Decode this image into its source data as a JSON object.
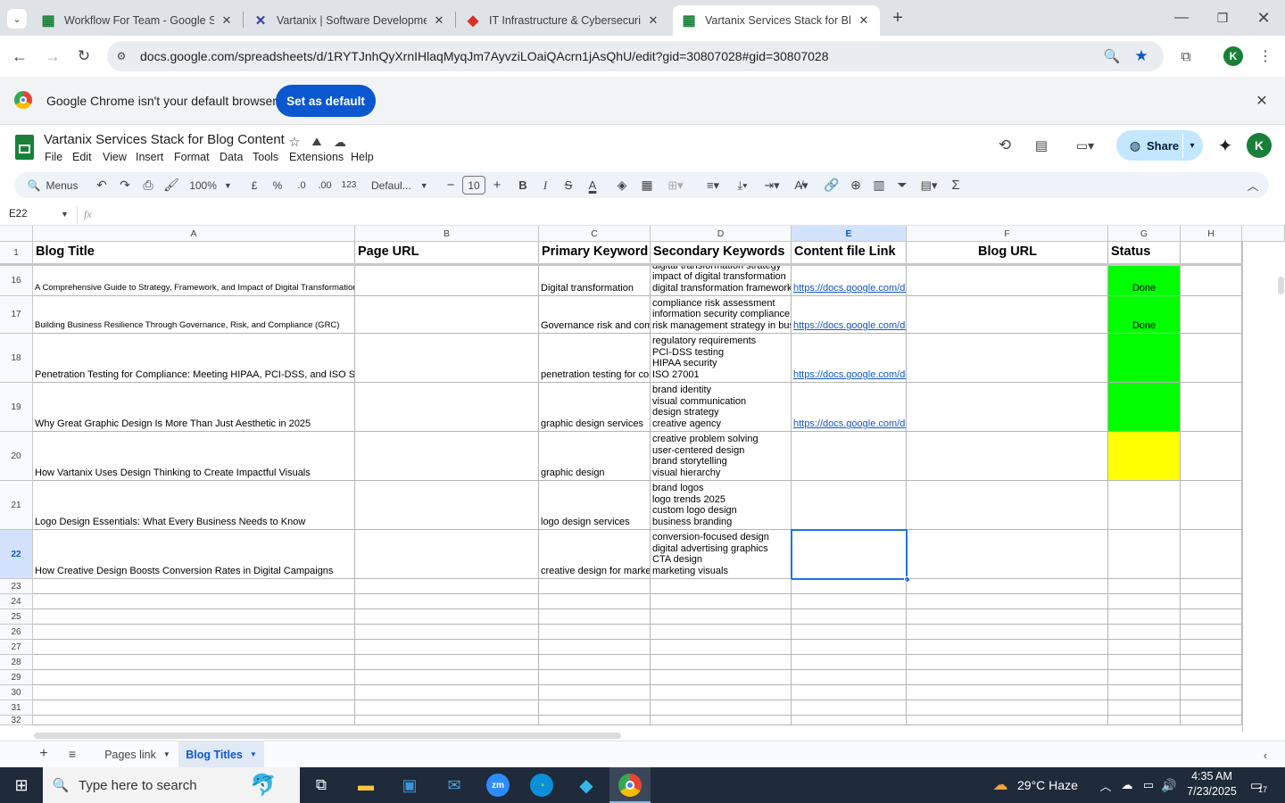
{
  "tabs": [
    {
      "title": "Workflow For Team - Google Sh",
      "fav": "sheets",
      "color": "#188038"
    },
    {
      "title": "Vartanix | Software Developmen",
      "fav": "x-logo",
      "color": "#2b3aa8"
    },
    {
      "title": "IT Infrastructure & Cybersecurit",
      "fav": "diamond",
      "color": "#d93025"
    },
    {
      "title": "Vartanix Services Stack for Blog",
      "fav": "sheets",
      "color": "#188038"
    }
  ],
  "url": "docs.google.com/spreadsheets/d/1RYTJnhQyXrnIHlaqMyqJm7AyvziLOaiQAcrn1jAsQhU/edit?gid=30807028#gid=30807028",
  "infobar": {
    "message": "Google Chrome isn't your default browser",
    "button": "Set as default"
  },
  "doc": {
    "title": "Vartanix Services Stack for Blog Content"
  },
  "menus": [
    "File",
    "Edit",
    "View",
    "Insert",
    "Format",
    "Data",
    "Tools",
    "Extensions",
    "Help"
  ],
  "toolbar": {
    "menus": "Menus",
    "zoom": "100%",
    "currency": "£",
    "percent": "%",
    "dec_less": ".0",
    "dec_more": ".00",
    "format123": "123",
    "font": "Defaul...",
    "font_size": "10",
    "bold": "B",
    "italic": "I",
    "strike": "S",
    "textcolor": "A"
  },
  "share": "Share",
  "avatar": "K",
  "namebox": "E22",
  "fx": "fx",
  "columns": [
    "A",
    "B",
    "C",
    "D",
    "E",
    "F",
    "G",
    "H"
  ],
  "headers": {
    "a": "Blog Title",
    "b": "Page URL",
    "c": "Primary Keyword",
    "d": "Secondary Keywords",
    "e": "Content file Link",
    "f": "Blog URL",
    "g": "Status"
  },
  "rows": [
    {
      "num": "16",
      "title": "A Comprehensive Guide to Strategy, Framework, and Impact of Digital Transformation",
      "primary": "Digital transformation",
      "secondary": [
        "digital transformation strategy",
        "impact of digital transformation",
        "digital transformation framework"
      ],
      "link": "https://docs.google.com/do",
      "status": "Done",
      "color": "green"
    },
    {
      "num": "17",
      "title": "Building Business Resilience Through Governance, Risk, and Compliance (GRC)",
      "primary": "Governance risk and com",
      "secondary": [
        "compliance risk assessment",
        "information security compliance",
        "risk management strategy in bus"
      ],
      "link": "https://docs.google.com/do",
      "status": "Done",
      "color": "green"
    },
    {
      "num": "18",
      "title": "Penetration Testing for Compliance: Meeting HIPAA, PCI-DSS, and ISO Sta",
      "primary": "penetration testing for cor",
      "secondary": [
        "regulatory requirements",
        "PCI-DSS testing",
        "HIPAA security",
        "ISO 27001"
      ],
      "link": "https://docs.google.com/do",
      "status": "",
      "color": "green"
    },
    {
      "num": "19",
      "title": "Why Great Graphic Design Is More Than Just Aesthetic in 2025",
      "primary": "graphic design services",
      "secondary": [
        "brand identity",
        "visual communication",
        "design strategy",
        "creative agency"
      ],
      "link": "https://docs.google.com/do",
      "status": "",
      "color": "green"
    },
    {
      "num": "20",
      "title": "How Vartanix Uses Design Thinking to Create Impactful Visuals",
      "primary": "graphic design",
      "secondary": [
        "creative problem solving",
        "user-centered design",
        "brand storytelling",
        "visual hierarchy"
      ],
      "link": "",
      "status": "",
      "color": "yellow"
    },
    {
      "num": "21",
      "title": "Logo Design Essentials: What Every Business Needs to Know",
      "primary": "logo design services",
      "secondary": [
        "brand logos",
        "logo trends 2025",
        "custom logo design",
        "business branding"
      ],
      "link": "",
      "status": "",
      "color": ""
    },
    {
      "num": "22",
      "title": "How Creative Design Boosts Conversion Rates in Digital Campaigns",
      "primary": "creative design for marke",
      "secondary": [
        "conversion-focused design",
        "digital advertising graphics",
        "CTA design",
        "marketing visuals"
      ],
      "link": "",
      "status": "",
      "color": ""
    }
  ],
  "empty_rows": [
    "23",
    "24",
    "25",
    "26",
    "27",
    "28",
    "29",
    "30",
    "31",
    "32"
  ],
  "sheets": {
    "tab1": "Pages link",
    "tab2": "Blog Titles"
  },
  "taskbar": {
    "search": "Type here to search",
    "weather": "29°C  Haze",
    "time": "4:35 AM",
    "date": "7/23/2025",
    "notif": "17"
  }
}
